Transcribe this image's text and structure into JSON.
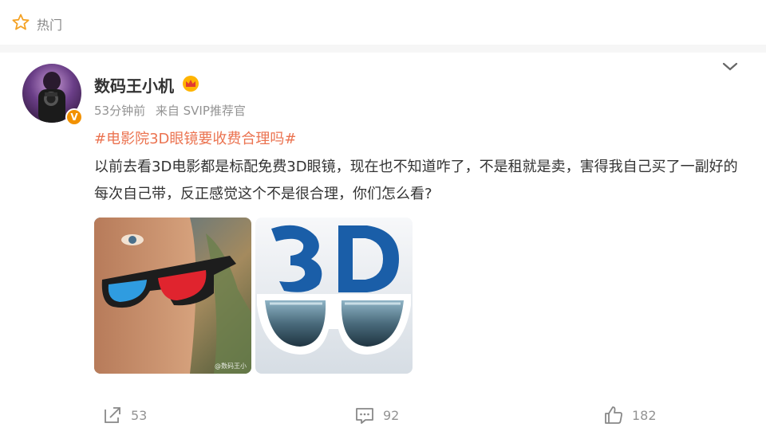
{
  "header": {
    "title": "热门",
    "icon": "star-icon"
  },
  "post": {
    "username": "数码王小机",
    "time": "53分钟前",
    "source": "来自 SVIP推荐官",
    "hashtag": "#电影院3D眼镜要收费合理吗#",
    "content": "以前去看3D电影都是标配免费3D眼镜，现在也不知道咋了，不是租就是卖，害得我自己买了一副好的每次自己带，反正感觉这个不是很合理，你们怎么看?",
    "badge": "V",
    "images": [
      {
        "name": "man-with-3d-glasses",
        "watermark": "@数码王小"
      },
      {
        "name": "3d-logo-glasses"
      }
    ]
  },
  "actions": {
    "repost_count": "53",
    "comment_count": "92",
    "like_count": "182"
  },
  "colors": {
    "accent": "#eb7350",
    "meta": "#939393",
    "vip": "#f29100"
  }
}
